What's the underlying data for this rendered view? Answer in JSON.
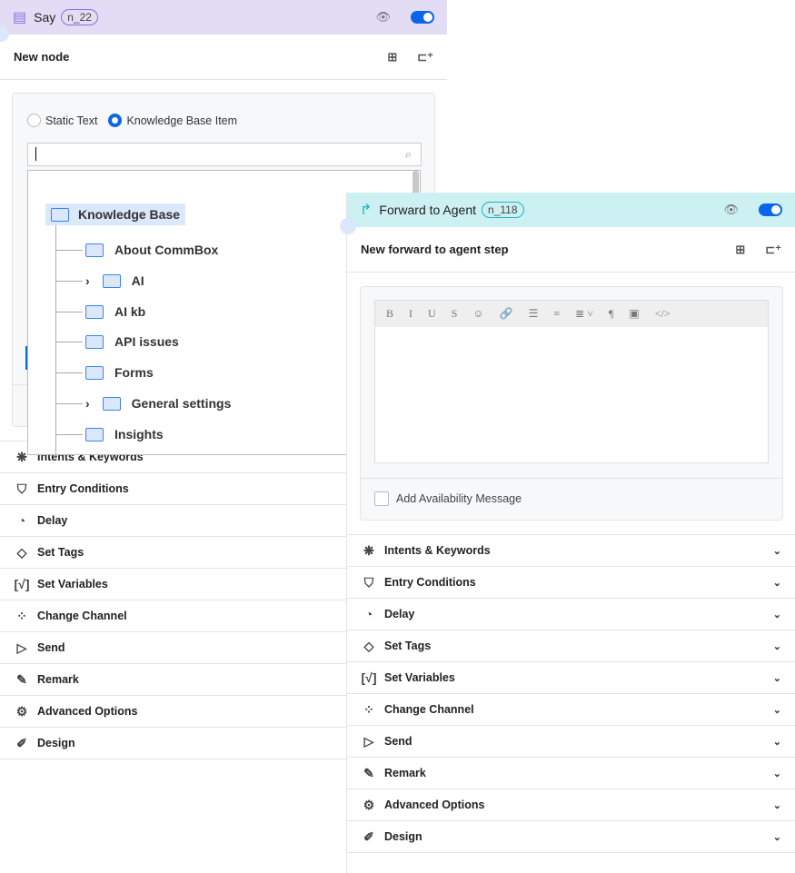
{
  "say": {
    "title": "Say",
    "badge": "n_22",
    "node_title": "New node",
    "header_bg": "#e3dcf5",
    "radio_static": "Static Text",
    "radio_kb": "Knowledge Base Item",
    "selected": "Knowledge Base Item",
    "search_value": "",
    "tree": {
      "root": "Knowledge Base",
      "items": [
        {
          "label": "About CommBox",
          "expandable": false
        },
        {
          "label": "AI",
          "expandable": true
        },
        {
          "label": "AI kb",
          "expandable": false
        },
        {
          "label": "API issues",
          "expandable": false
        },
        {
          "label": "Forms",
          "expandable": false
        },
        {
          "label": "General settings",
          "expandable": true
        },
        {
          "label": "Insights",
          "expandable": false
        }
      ]
    },
    "sections": [
      "Intents & Keywords",
      "Entry Conditions",
      "Delay",
      "Set Tags",
      "Set Variables",
      "Change Channel",
      "Send",
      "Remark",
      "Advanced Options",
      "Design"
    ]
  },
  "forward": {
    "title": "Forward to Agent",
    "badge": "n_118",
    "node_title": "New forward to agent step",
    "header_bg": "#cdf0f2",
    "availability_label": "Add Availability Message",
    "sections": [
      "Intents & Keywords",
      "Entry Conditions",
      "Delay",
      "Set Tags",
      "Set Variables",
      "Change Channel",
      "Send",
      "Remark",
      "Advanced Options",
      "Design"
    ]
  },
  "toolbar": [
    "B",
    "I",
    "U",
    "S",
    "☺",
    "🔗",
    "☰",
    "≡",
    "≣ ˅",
    "¶",
    "▣",
    "</>"
  ],
  "icons": [
    "brain-icon",
    "filter-icon",
    "clock-icon",
    "tag-icon",
    "variable-icon",
    "grid-icon",
    "send-icon",
    "remark-icon",
    "gear-icon",
    "design-icon"
  ],
  "accent": "#0a66e8"
}
